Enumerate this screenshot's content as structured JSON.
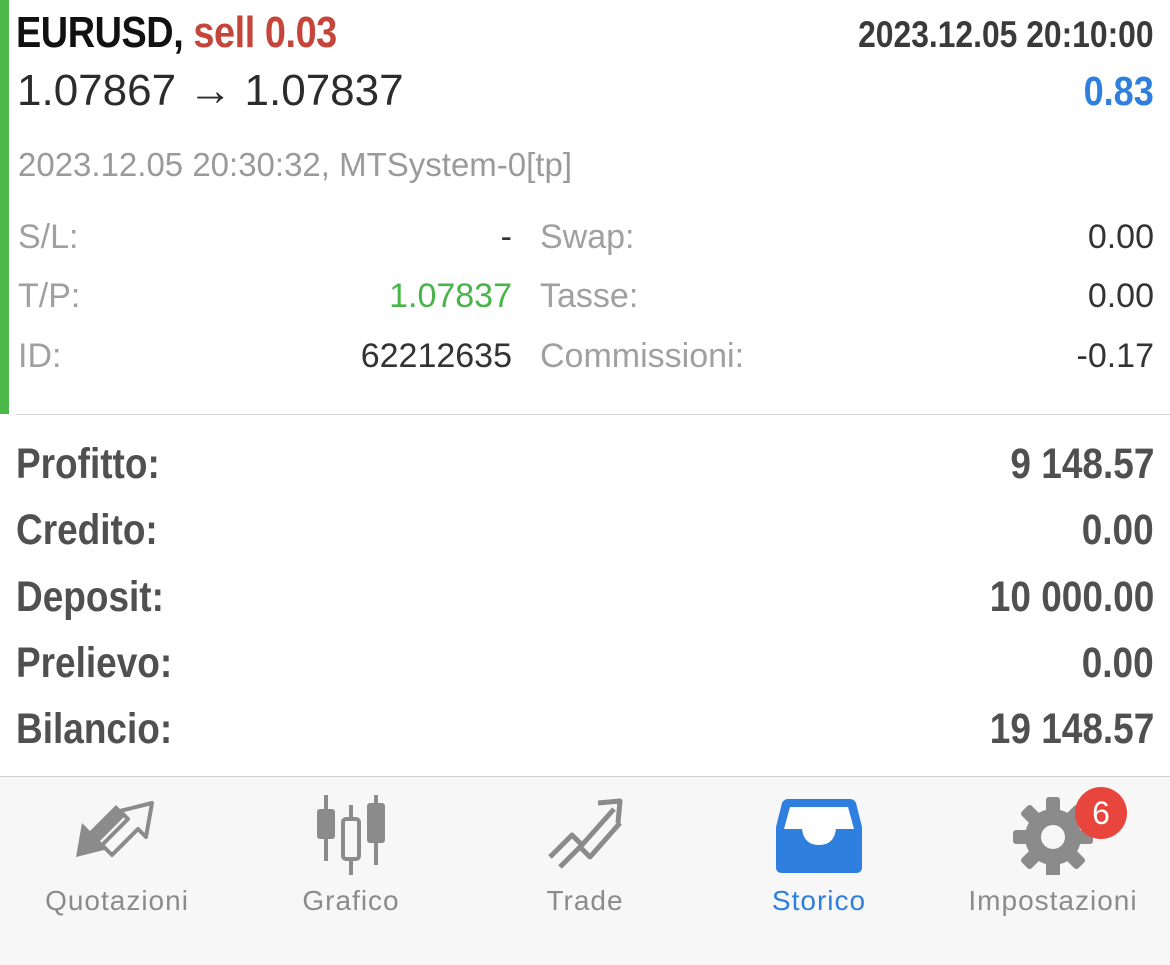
{
  "deal": {
    "symbol": "EURUSD,",
    "side_volume": "sell 0.03",
    "open_time": "2023.12.05 20:10:00",
    "open_price": "1.07867",
    "arrow": "→",
    "close_price": "1.07837",
    "profit": "0.83",
    "close_info": "2023.12.05 20:30:32, MTSystem-0[tp]",
    "sl_label": "S/L:",
    "sl_value": "-",
    "tp_label": "T/P:",
    "tp_value": "1.07837",
    "id_label": "ID:",
    "id_value": "62212635",
    "swap_label": "Swap:",
    "swap_value": "0.00",
    "taxes_label": "Tasse:",
    "taxes_value": "0.00",
    "commission_label": "Commissioni:",
    "commission_value": "-0.17",
    "colors": {
      "bar": "#4cb84a",
      "side": "#c6453a",
      "profit": "#2e7fde",
      "tp": "#49b449"
    }
  },
  "summary": {
    "profit_label": "Profitto:",
    "profit_value": "9 148.57",
    "credit_label": "Credito:",
    "credit_value": "0.00",
    "deposit_label": "Deposit:",
    "deposit_value": "10 000.00",
    "withdrawal_label": "Prelievo:",
    "withdrawal_value": "0.00",
    "balance_label": "Bilancio:",
    "balance_value": "19 148.57"
  },
  "tabs": [
    {
      "label": "Quotazioni",
      "icon": "quotes-arrows-icon",
      "active": false
    },
    {
      "label": "Grafico",
      "icon": "candlestick-chart-icon",
      "active": false
    },
    {
      "label": "Trade",
      "icon": "trend-arrow-icon",
      "active": false
    },
    {
      "label": "Storico",
      "icon": "inbox-tray-icon",
      "active": true
    },
    {
      "label": "Impostazioni",
      "icon": "gear-icon",
      "active": false
    }
  ],
  "settings_badge": "6",
  "accent_color": "#2e7fde"
}
